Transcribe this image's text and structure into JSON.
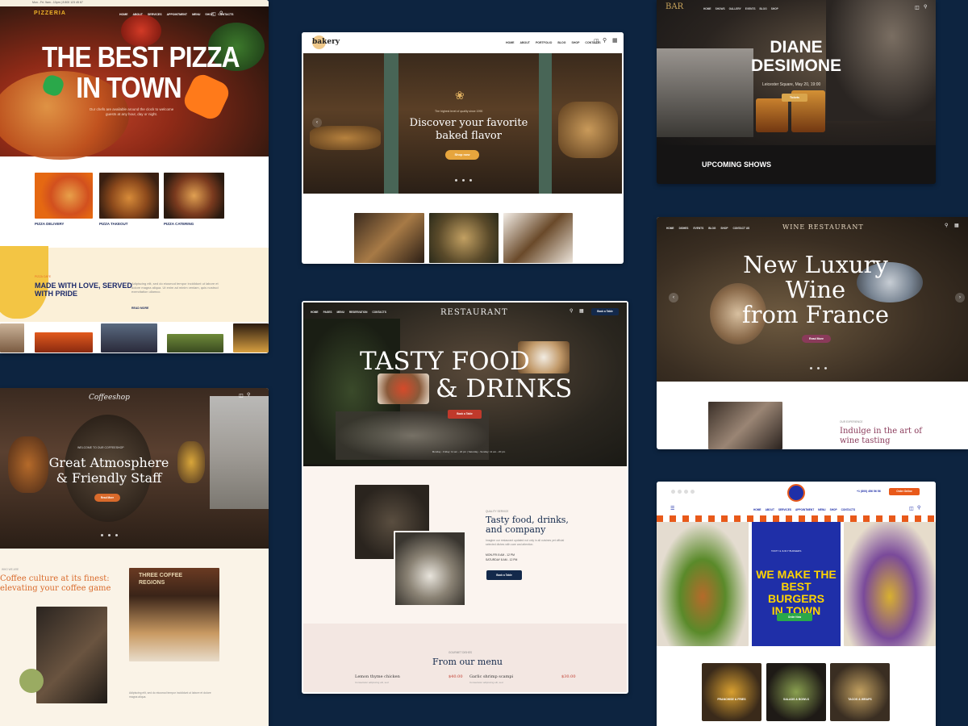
{
  "background_color": "#0d2440",
  "pizzeria": {
    "logo": "PIZZERIA",
    "topbar_text": "Mon - Fri: 9am - 10pm  |  8 800 123 45 67",
    "nav": [
      "Home",
      "About",
      "Services",
      "Appointment",
      "Menu",
      "Shop",
      "Contacts"
    ],
    "headline_1": "THE BEST PIZZA",
    "headline_2": "IN TOWN",
    "hero_text": "Our chefs are available around the clock to welcome guests at any hour, day or night.",
    "services": [
      "PIZZA DELIVERY",
      "PIZZA TAKEOUT",
      "PIZZA CATERING"
    ],
    "about_kicker": "Pizza Cafe",
    "about_title_1": "MADE WITH LOVE, SERVED",
    "about_title_2": "WITH PRIDE",
    "about_text": "Adipiscing elit, sed do eiusmod tempor incididunt ut labore et dolore magna aliqua. Ut enim ad minim veniam, quis nostrud exercitation ullamco.",
    "read_more": "READ MORE",
    "accent_color": "#f0b429"
  },
  "bakery": {
    "logo": "bakery",
    "nav": [
      "Home",
      "About",
      "Portfolio",
      "Blog",
      "Shop",
      "Contacts"
    ],
    "kicker": "The highest level of quality since 1990",
    "headline_1": "Discover your favorite",
    "headline_2": "baked flavor",
    "button": "Shop now"
  },
  "bar": {
    "logo": "BAR",
    "nav": [
      "Home",
      "Shows",
      "Gallery",
      "Events",
      "Blog",
      "Shop"
    ],
    "artist_1": "DIANE",
    "artist_2": "DESIMONE",
    "event": "Leicester Square, May 20, 19:00",
    "button": "Tickets",
    "section": "UPCOMING SHOWS"
  },
  "wine": {
    "logo": "WINE RESTAURANT",
    "nav": [
      "Home",
      "Dishes",
      "Events",
      "Blog",
      "Shop",
      "Contact Us"
    ],
    "headline_1": "New Luxury",
    "headline_2": "Wine",
    "headline_3": "from France",
    "button": "Read More",
    "kicker": "Our Experience",
    "subtitle_1": "Indulge in the art of",
    "subtitle_2": "wine tasting",
    "accent_color": "#8a3a5a"
  },
  "restaurant": {
    "logo": "RESTAURANT",
    "nav": [
      "Home",
      "Pages",
      "Menu",
      "Reservation",
      "Contacts"
    ],
    "cta": "Book a Table",
    "headline_1": "TASTY FOOD",
    "headline_2": "& DRINKS",
    "hero_button": "Book a Table",
    "hero_caption": "Monday - Friday: 11 am - 22 pm  |  Saturday - Sunday: 11 am - 20 pm",
    "about_kicker": "Quality Service",
    "about_title_1": "Tasty food, drinks,",
    "about_title_2": "and company",
    "about_text": "Imagine our restaurant updated not only in all cuisines yet official selected dishes with care and attention.",
    "hours_1": "MON-FRI 8 AM - 12 PM",
    "hours_2": "SATURDAY 8 AM - 12 PM",
    "about_button": "Book a Table",
    "menu_kicker": "Gourmet Dishes",
    "menu_title": "From our menu",
    "menu_items": [
      {
        "name": "Lemon thyme chicken",
        "price": "$40.00",
        "desc": "Consectetur adipiscing elit, sed"
      },
      {
        "name": "Garlic shrimp scampi",
        "price": "$30.00",
        "desc": "Consectetur adipiscing elit, sed"
      }
    ],
    "accent_color": "#c0392b",
    "navy_color": "#13294b"
  },
  "coffee": {
    "logo": "Coffeeshop",
    "kicker": "Welcome to our coffeeshop",
    "headline_1": "Great Atmosphere",
    "headline_2": "& Friendly Staff",
    "button": "Read More",
    "section_kicker": "Who We Are",
    "title_1": "Coffee culture at its finest:",
    "title_2": "elevating your coffee game",
    "body": "Adipiscing elit, sed do eiusmod tempor incididunt ut labore et dolore magna aliqua.",
    "sign_1": "THREE COFFEE",
    "sign_2": "REGIONS",
    "accent_color": "#d96a2b"
  },
  "burgers": {
    "nav": [
      "Home",
      "About",
      "Services",
      "Appointment",
      "Menu",
      "Shop",
      "Contacts"
    ],
    "phone": "+1 (800) 456 56 56",
    "cta": "Order Online",
    "headline_1": "WE MAKE THE",
    "headline_2": "BEST BURGERS",
    "headline_3": "IN TOWN",
    "kicker": "Tasty & Juicy Burgers",
    "button": "Order Now",
    "categories": [
      "FRANCHISE & FRIES",
      "SALADS & BOWLS",
      "TACOS & WRAPS"
    ],
    "blue_color": "#1f2fa8",
    "yellow_color": "#ffd400",
    "orange_color": "#e8591a"
  }
}
